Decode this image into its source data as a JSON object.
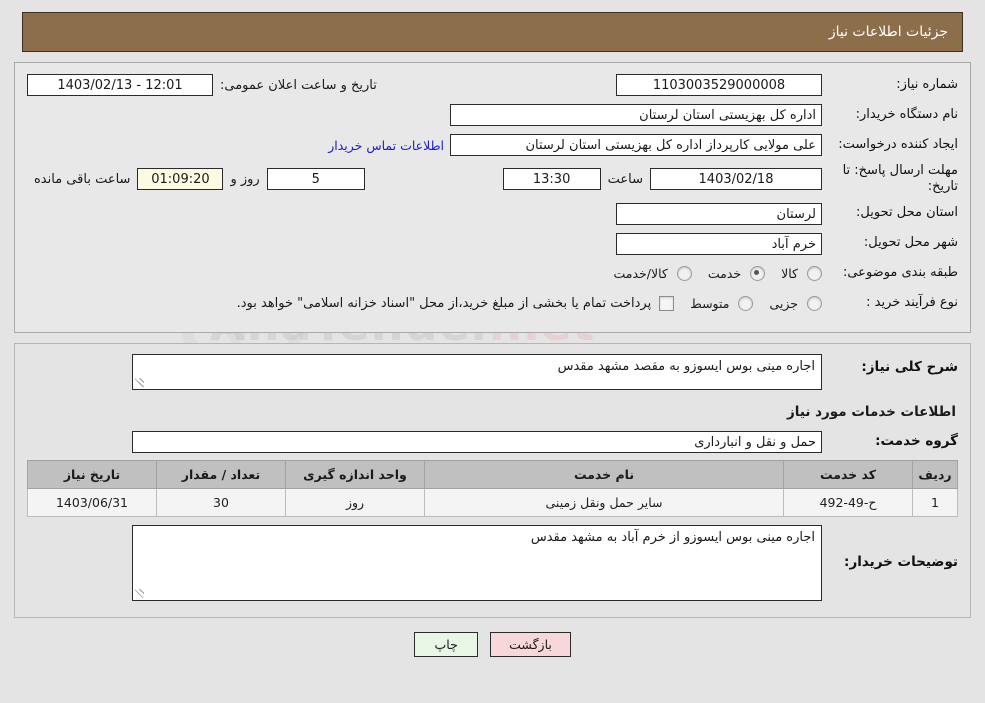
{
  "header": {
    "title": "جزئیات اطلاعات نیاز"
  },
  "info": {
    "need_number_label": "شماره نیاز:",
    "need_number_value": "1103003529000008",
    "public_announce_label": "تاریخ و ساعت اعلان عمومی:",
    "public_announce_value": "12:01 - 1403/02/13",
    "buyer_org_label": "نام دستگاه خریدار:",
    "buyer_org_value": "اداره کل بهزیستی استان لرستان",
    "requester_label": "ایجاد کننده درخواست:",
    "requester_value": "علی مولایی کارپرداز اداره کل بهزیستی استان لرستان",
    "contact_link": "اطلاعات تماس خریدار",
    "deadline_label": "مهلت ارسال پاسخ: تا تاریخ:",
    "deadline_date": "1403/02/18",
    "hour_label": "ساعت",
    "deadline_time": "13:30",
    "days_remaining": "5",
    "days_label": "روز و",
    "timer_value": "01:09:20",
    "timer_label": "ساعت باقی مانده",
    "province_label": "استان محل تحویل:",
    "province_value": "لرستان",
    "city_label": "شهر محل تحویل:",
    "city_value": "خرم آباد",
    "category_label": "طبقه بندی موضوعی:",
    "category_options": [
      {
        "label": "کالا",
        "selected": false
      },
      {
        "label": "خدمت",
        "selected": true
      },
      {
        "label": "کالا/خدمت",
        "selected": false
      }
    ],
    "process_label": "نوع فرآیند خرید :",
    "process_options": [
      {
        "label": "جزیی",
        "selected": false
      },
      {
        "label": "متوسط",
        "selected": false
      }
    ],
    "treasury_checkbox_text": "پرداخت تمام یا بخشی از مبلغ خرید،از محل \"اسناد خزانه اسلامی\" خواهد بود.",
    "treasury_checked": false
  },
  "description": {
    "label": "شرح کلی نیاز:",
    "value": "اجاره مینی بوس ایسوزو به مقصد مشهد مقدس"
  },
  "services_section": {
    "heading": "اطلاعات خدمات مورد نیاز",
    "group_label": "گروه خدمت:",
    "group_value": "حمل و نقل و انبارداری"
  },
  "table": {
    "columns": [
      "ردیف",
      "کد خدمت",
      "نام خدمت",
      "واحد اندازه گیری",
      "تعداد / مقدار",
      "تاریخ نیاز"
    ],
    "rows": [
      {
        "index": "1",
        "code": "ح-49-492",
        "name": "سایر حمل ونقل زمینی",
        "unit": "روز",
        "quantity": "30",
        "date": "1403/06/31"
      }
    ]
  },
  "buyer_notes": {
    "label": "توضیحات خریدار:",
    "value": "اجاره مینی بوس ایسوزو از خرم آباد به مشهد مقدس"
  },
  "footer": {
    "print_label": "چاپ",
    "back_label": "بازگشت"
  },
  "watermark": {
    "text_left": "Ana",
    "text_right": "Tender",
    "text_suffix": ".net"
  },
  "colors": {
    "header_bg": "#8d6e4b",
    "link": "#1b1bd0",
    "table_header_bg": "#c0c0c0",
    "print_btn_bg": "#e8f6e6",
    "back_btn_bg": "#f8d7da",
    "timer_bg": "#fbfbe2"
  }
}
